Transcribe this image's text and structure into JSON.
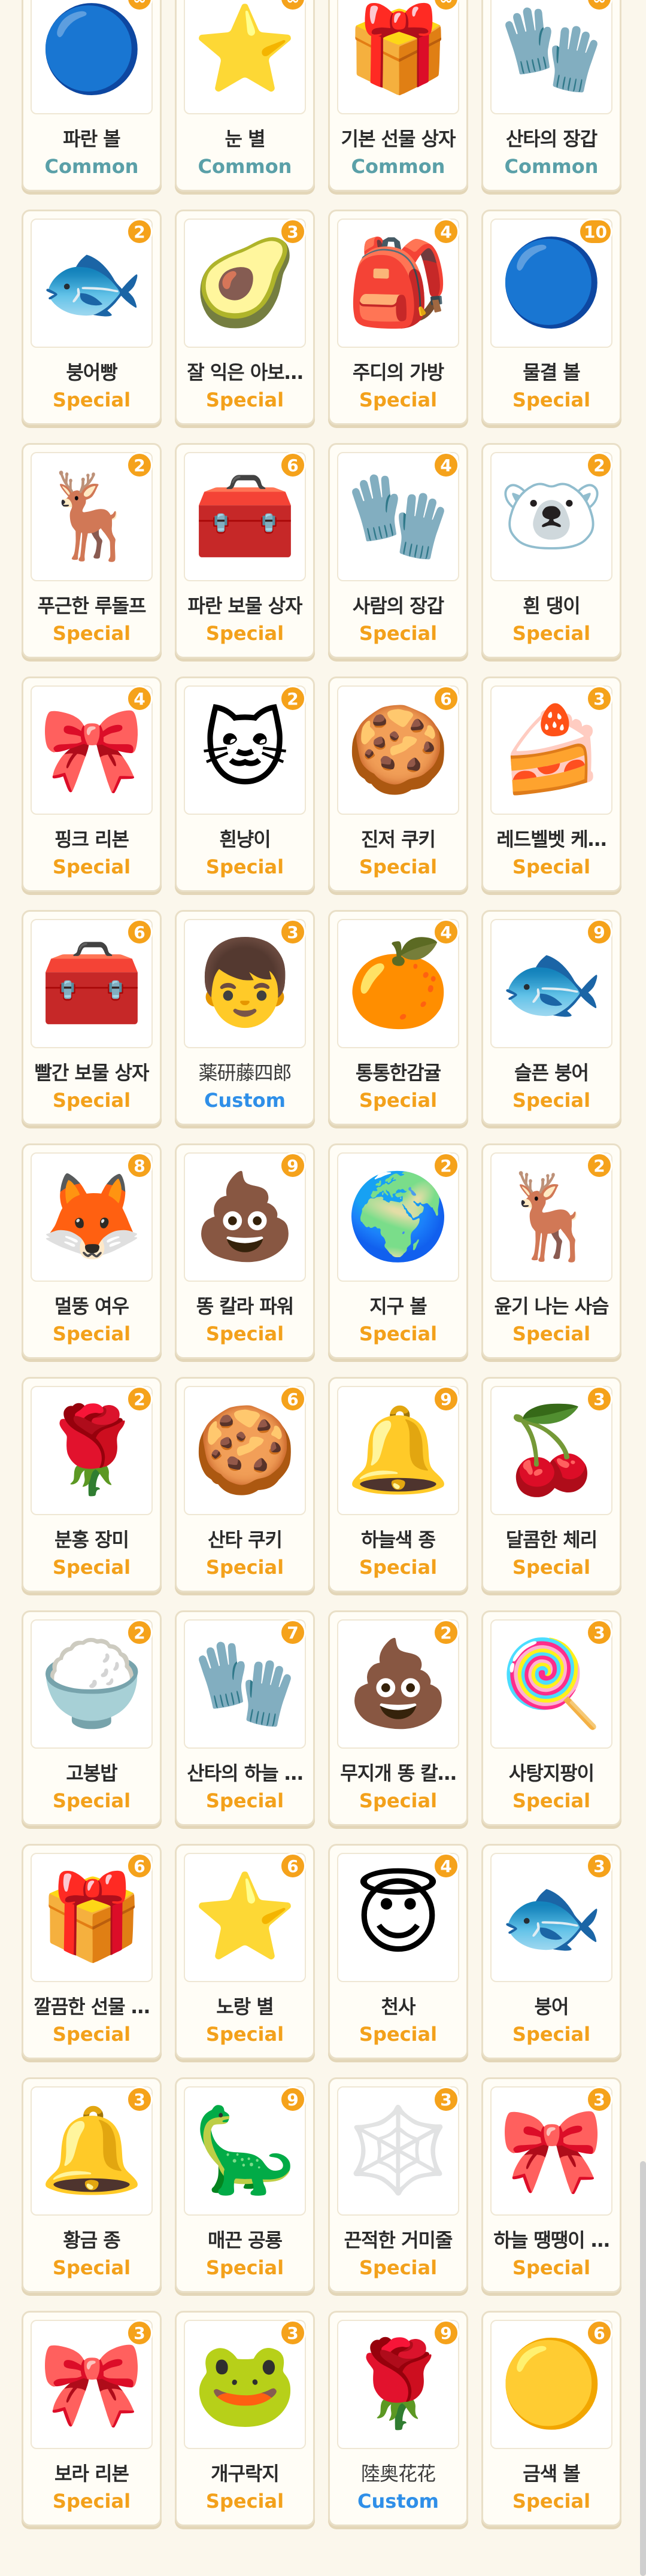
{
  "items": [
    {
      "name": "파란 볼",
      "rarity": "Common",
      "count": "∞",
      "icon": "blue-ornament",
      "glyph": "🔵"
    },
    {
      "name": "눈 별",
      "rarity": "Common",
      "count": "∞",
      "icon": "snow-star",
      "glyph": "⭐"
    },
    {
      "name": "기본 선물 상자",
      "rarity": "Common",
      "count": "∞",
      "icon": "gift-box",
      "glyph": "🎁"
    },
    {
      "name": "산타의 장갑",
      "rarity": "Common",
      "count": "∞",
      "icon": "red-mitten",
      "glyph": "🧤"
    },
    {
      "name": "붕어빵",
      "rarity": "Special",
      "count": "2",
      "icon": "fish-bread",
      "glyph": "🐟"
    },
    {
      "name": "잘 익은 아보…",
      "rarity": "Special",
      "count": "3",
      "icon": "avocado",
      "glyph": "🥑"
    },
    {
      "name": "주디의 가방",
      "rarity": "Special",
      "count": "4",
      "icon": "red-backpack",
      "glyph": "🎒"
    },
    {
      "name": "물결 볼",
      "rarity": "Special",
      "count": "10",
      "icon": "wave-ornament",
      "glyph": "🔵"
    },
    {
      "name": "푸근한 루돌프",
      "rarity": "Special",
      "count": "2",
      "icon": "reindeer-face",
      "glyph": "🦌"
    },
    {
      "name": "파란 보물 상자",
      "rarity": "Special",
      "count": "6",
      "icon": "blue-treasure-chest",
      "glyph": "🧰"
    },
    {
      "name": "사람의 장갑",
      "rarity": "Special",
      "count": "4",
      "icon": "blue-mitten",
      "glyph": "🧤"
    },
    {
      "name": "흰 댕이",
      "rarity": "Special",
      "count": "2",
      "icon": "white-bear",
      "glyph": "🐻‍❄️"
    },
    {
      "name": "핑크 리본",
      "rarity": "Special",
      "count": "4",
      "icon": "pink-ribbon",
      "glyph": "🎀"
    },
    {
      "name": "흰냥이",
      "rarity": "Special",
      "count": "2",
      "icon": "white-cat",
      "glyph": "🐱"
    },
    {
      "name": "진저 쿠키",
      "rarity": "Special",
      "count": "6",
      "icon": "gingerbread-cookie",
      "glyph": "🍪"
    },
    {
      "name": "레드벨벳 케…",
      "rarity": "Special",
      "count": "3",
      "icon": "red-velvet-cake",
      "glyph": "🍰"
    },
    {
      "name": "빨간 보물 상자",
      "rarity": "Special",
      "count": "6",
      "icon": "red-treasure-chest",
      "glyph": "🧰"
    },
    {
      "name": "薬研藤四郎",
      "rarity": "Custom",
      "count": "3",
      "icon": "custom-avatar",
      "glyph": "👦"
    },
    {
      "name": "통통한감귤",
      "rarity": "Special",
      "count": "4",
      "icon": "tangerine",
      "glyph": "🍊"
    },
    {
      "name": "슬픈 붕어",
      "rarity": "Special",
      "count": "9",
      "icon": "fish-bone",
      "glyph": "🐟"
    },
    {
      "name": "멀뚱 여우",
      "rarity": "Special",
      "count": "8",
      "icon": "fox",
      "glyph": "🦊"
    },
    {
      "name": "똥 칼라 파워",
      "rarity": "Special",
      "count": "9",
      "icon": "poop",
      "glyph": "💩"
    },
    {
      "name": "지구 볼",
      "rarity": "Special",
      "count": "2",
      "icon": "earth-ornament",
      "glyph": "🌍"
    },
    {
      "name": "윤기 나는 사슴",
      "rarity": "Special",
      "count": "2",
      "icon": "deer",
      "glyph": "🦌"
    },
    {
      "name": "분홍 장미",
      "rarity": "Special",
      "count": "2",
      "icon": "pink-rose",
      "glyph": "🌹"
    },
    {
      "name": "산타 쿠키",
      "rarity": "Special",
      "count": "6",
      "icon": "santa-cookie",
      "glyph": "🍪"
    },
    {
      "name": "하늘색 종",
      "rarity": "Special",
      "count": "9",
      "icon": "sky-bell",
      "glyph": "🔔"
    },
    {
      "name": "달콤한 체리",
      "rarity": "Special",
      "count": "3",
      "icon": "cherry",
      "glyph": "🍒"
    },
    {
      "name": "고봉밥",
      "rarity": "Special",
      "count": "2",
      "icon": "rice-bowl",
      "glyph": "🍚"
    },
    {
      "name": "산타의 하늘 …",
      "rarity": "Special",
      "count": "7",
      "icon": "sky-mitten",
      "glyph": "🧤"
    },
    {
      "name": "무지개 똥 칼…",
      "rarity": "Special",
      "count": "2",
      "icon": "rainbow-poop",
      "glyph": "💩"
    },
    {
      "name": "사탕지팡이",
      "rarity": "Special",
      "count": "3",
      "icon": "candy-cane",
      "glyph": "🍭"
    },
    {
      "name": "깔끔한 선물 …",
      "rarity": "Special",
      "count": "6",
      "icon": "pink-gift",
      "glyph": "🎁"
    },
    {
      "name": "노랑 별",
      "rarity": "Special",
      "count": "6",
      "icon": "yellow-star",
      "glyph": "⭐"
    },
    {
      "name": "천사",
      "rarity": "Special",
      "count": "4",
      "icon": "angel-face",
      "glyph": "😇"
    },
    {
      "name": "붕어",
      "rarity": "Special",
      "count": "3",
      "icon": "blue-fish",
      "glyph": "🐟"
    },
    {
      "name": "황금 종",
      "rarity": "Special",
      "count": "3",
      "icon": "golden-bell",
      "glyph": "🔔"
    },
    {
      "name": "매끈 공룡",
      "rarity": "Special",
      "count": "9",
      "icon": "dinosaur",
      "glyph": "🦕"
    },
    {
      "name": "끈적한 거미줄",
      "rarity": "Special",
      "count": "3",
      "icon": "spider-web",
      "glyph": "🕸️"
    },
    {
      "name": "하늘 땡땡이 …",
      "rarity": "Special",
      "count": "3",
      "icon": "blue-polka-ribbon",
      "glyph": "🎀"
    },
    {
      "name": "보라 리본",
      "rarity": "Special",
      "count": "3",
      "icon": "purple-ribbon",
      "glyph": "🎀"
    },
    {
      "name": "개구락지",
      "rarity": "Special",
      "count": "3",
      "icon": "frog",
      "glyph": "🐸"
    },
    {
      "name": "陸奥花花",
      "rarity": "Custom",
      "count": "9",
      "icon": "orange-rose",
      "glyph": "🌹"
    },
    {
      "name": "금색 볼",
      "rarity": "Special",
      "count": "6",
      "icon": "gold-ornament",
      "glyph": "🟡"
    }
  ]
}
